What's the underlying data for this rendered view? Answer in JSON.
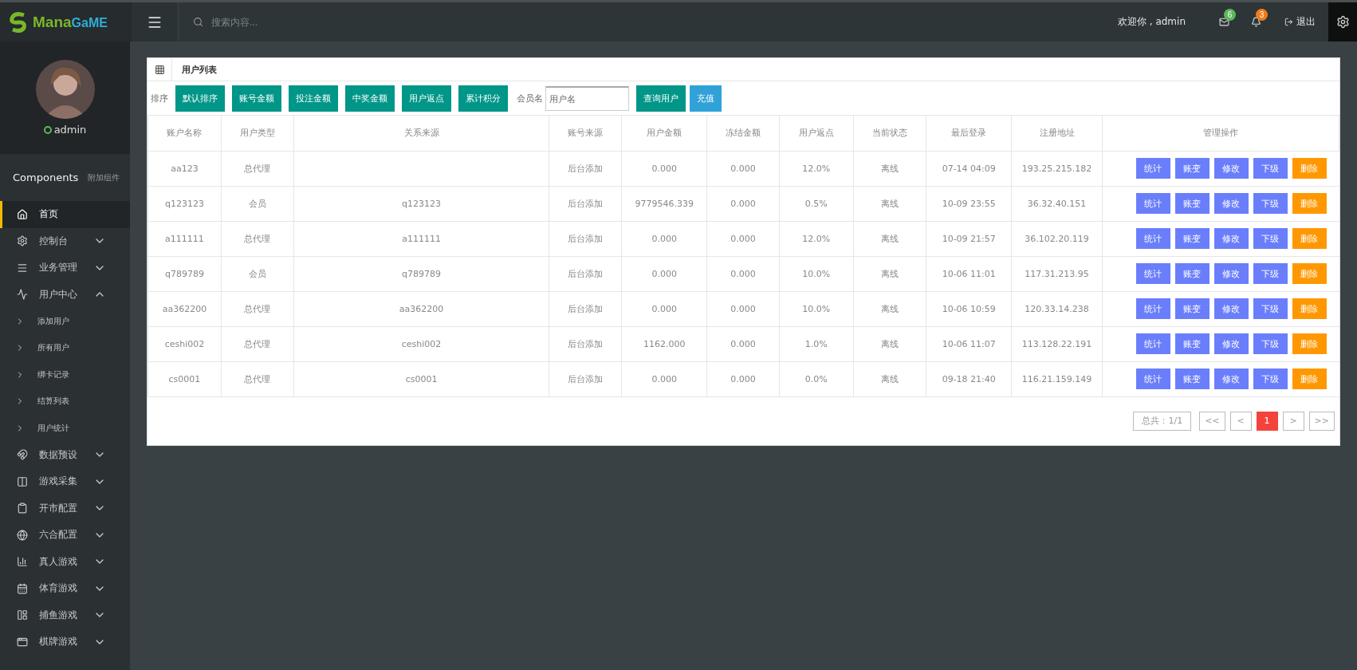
{
  "brand": {
    "part1": "Mana",
    "part2": "GaME"
  },
  "search": {
    "placeholder": "搜索内容..."
  },
  "topbar": {
    "welcome": "欢迎你 , admin",
    "messages_badge": "6",
    "notifications_badge": "3",
    "logout": "退出"
  },
  "user": {
    "name": "admin",
    "online": true
  },
  "sidebar": {
    "title": "Components",
    "subtitle": "附加组件",
    "items": [
      {
        "label": "首页",
        "selected": true
      },
      {
        "label": "控制台",
        "selected": false,
        "expanded": false
      },
      {
        "label": "业务管理",
        "selected": false,
        "expanded": false
      },
      {
        "label": "用户中心",
        "selected": false,
        "expanded": true,
        "children": [
          {
            "label": "添加用户",
            "selected": false
          },
          {
            "label": "所有用户",
            "selected": false
          },
          {
            "label": "绑卡记录",
            "selected": false
          },
          {
            "label": "结算列表",
            "selected": false
          },
          {
            "label": "用户统计",
            "selected": false
          }
        ]
      },
      {
        "label": "数据预设",
        "selected": false,
        "expanded": false
      },
      {
        "label": "游戏采集",
        "selected": false,
        "expanded": false
      },
      {
        "label": "开市配置",
        "selected": false,
        "expanded": false
      },
      {
        "label": "六合配置",
        "selected": false,
        "expanded": false
      },
      {
        "label": "真人游戏",
        "selected": false,
        "expanded": false
      },
      {
        "label": "体育游戏",
        "selected": false,
        "expanded": false
      },
      {
        "label": "捕鱼游戏",
        "selected": false,
        "expanded": false
      },
      {
        "label": "棋牌游戏",
        "selected": false,
        "expanded": false
      }
    ]
  },
  "panel": {
    "title": "用户列表"
  },
  "toolbar": {
    "sort_label": "排序",
    "sort_buttons": [
      "默认排序",
      "账号金额",
      "投注金额",
      "中奖金额",
      "用户返点",
      "累计积分"
    ],
    "member_label": "会员名",
    "member_field": {
      "placeholder": "用户名"
    },
    "query_button": "查询用户",
    "recharge_button": "充值"
  },
  "table": {
    "columns": [
      "账户名称",
      "用户类型",
      "关系来源",
      "账号来源",
      "用户金额",
      "冻结金额",
      "用户返点",
      "当前状态",
      "最后登录",
      "注册地址",
      "管理操作"
    ],
    "rows": [
      {
        "cells": [
          "aa123",
          "总代理",
          "",
          "后台添加",
          "0.000",
          "0.000",
          "12.0%",
          "离线",
          "07-14 04:09",
          "193.25.215.182"
        ],
        "actions": [
          {
            "label": "统计",
            "kind": "normal"
          },
          {
            "label": "账变",
            "kind": "normal"
          },
          {
            "label": "修改",
            "kind": "normal"
          },
          {
            "label": "下级",
            "kind": "normal"
          },
          {
            "label": "删除",
            "kind": "danger"
          }
        ]
      },
      {
        "cells": [
          "q123123",
          "会员",
          "q123123",
          "后台添加",
          "9779546.339",
          "0.000",
          "0.5%",
          "离线",
          "10-09 23:55",
          "36.32.40.151"
        ],
        "actions": [
          {
            "label": "统计",
            "kind": "normal"
          },
          {
            "label": "账变",
            "kind": "normal"
          },
          {
            "label": "修改",
            "kind": "normal"
          },
          {
            "label": "下级",
            "kind": "normal"
          },
          {
            "label": "删除",
            "kind": "danger"
          }
        ]
      },
      {
        "cells": [
          "a111111",
          "总代理",
          "a111111",
          "后台添加",
          "0.000",
          "0.000",
          "12.0%",
          "离线",
          "10-09 21:57",
          "36.102.20.119"
        ],
        "actions": [
          {
            "label": "统计",
            "kind": "normal"
          },
          {
            "label": "账变",
            "kind": "normal"
          },
          {
            "label": "修改",
            "kind": "normal"
          },
          {
            "label": "下级",
            "kind": "normal"
          },
          {
            "label": "删除",
            "kind": "danger"
          }
        ]
      },
      {
        "cells": [
          "q789789",
          "会员",
          "q789789",
          "后台添加",
          "0.000",
          "0.000",
          "10.0%",
          "离线",
          "10-06 11:01",
          "117.31.213.95"
        ],
        "actions": [
          {
            "label": "统计",
            "kind": "normal"
          },
          {
            "label": "账变",
            "kind": "normal"
          },
          {
            "label": "修改",
            "kind": "normal"
          },
          {
            "label": "下级",
            "kind": "normal"
          },
          {
            "label": "删除",
            "kind": "danger"
          }
        ]
      },
      {
        "cells": [
          "aa362200",
          "总代理",
          "aa362200",
          "后台添加",
          "0.000",
          "0.000",
          "10.0%",
          "离线",
          "10-06 10:59",
          "120.33.14.238"
        ],
        "actions": [
          {
            "label": "统计",
            "kind": "normal"
          },
          {
            "label": "账变",
            "kind": "normal"
          },
          {
            "label": "修改",
            "kind": "normal"
          },
          {
            "label": "下级",
            "kind": "normal"
          },
          {
            "label": "删除",
            "kind": "danger"
          }
        ]
      },
      {
        "cells": [
          "ceshi002",
          "总代理",
          "ceshi002",
          "后台添加",
          "1162.000",
          "0.000",
          "1.0%",
          "离线",
          "10-06 11:07",
          "113.128.22.191"
        ],
        "actions": [
          {
            "label": "统计",
            "kind": "normal"
          },
          {
            "label": "账变",
            "kind": "normal"
          },
          {
            "label": "修改",
            "kind": "normal"
          },
          {
            "label": "下级",
            "kind": "normal"
          },
          {
            "label": "删除",
            "kind": "danger"
          }
        ]
      },
      {
        "cells": [
          "cs0001",
          "总代理",
          "cs0001",
          "后台添加",
          "0.000",
          "0.000",
          "0.0%",
          "离线",
          "09-18 21:40",
          "116.21.159.149"
        ],
        "actions": [
          {
            "label": "统计",
            "kind": "normal"
          },
          {
            "label": "账变",
            "kind": "normal"
          },
          {
            "label": "修改",
            "kind": "normal"
          },
          {
            "label": "下级",
            "kind": "normal"
          },
          {
            "label": "删除",
            "kind": "danger"
          }
        ]
      }
    ]
  },
  "pagination": {
    "total": "总共：1/1",
    "pages": [
      {
        "label": "<<",
        "selected": false
      },
      {
        "label": "<",
        "selected": false
      },
      {
        "label": "1",
        "selected": true
      },
      {
        "label": ">",
        "selected": false
      },
      {
        "label": ">>",
        "selected": false
      }
    ]
  }
}
